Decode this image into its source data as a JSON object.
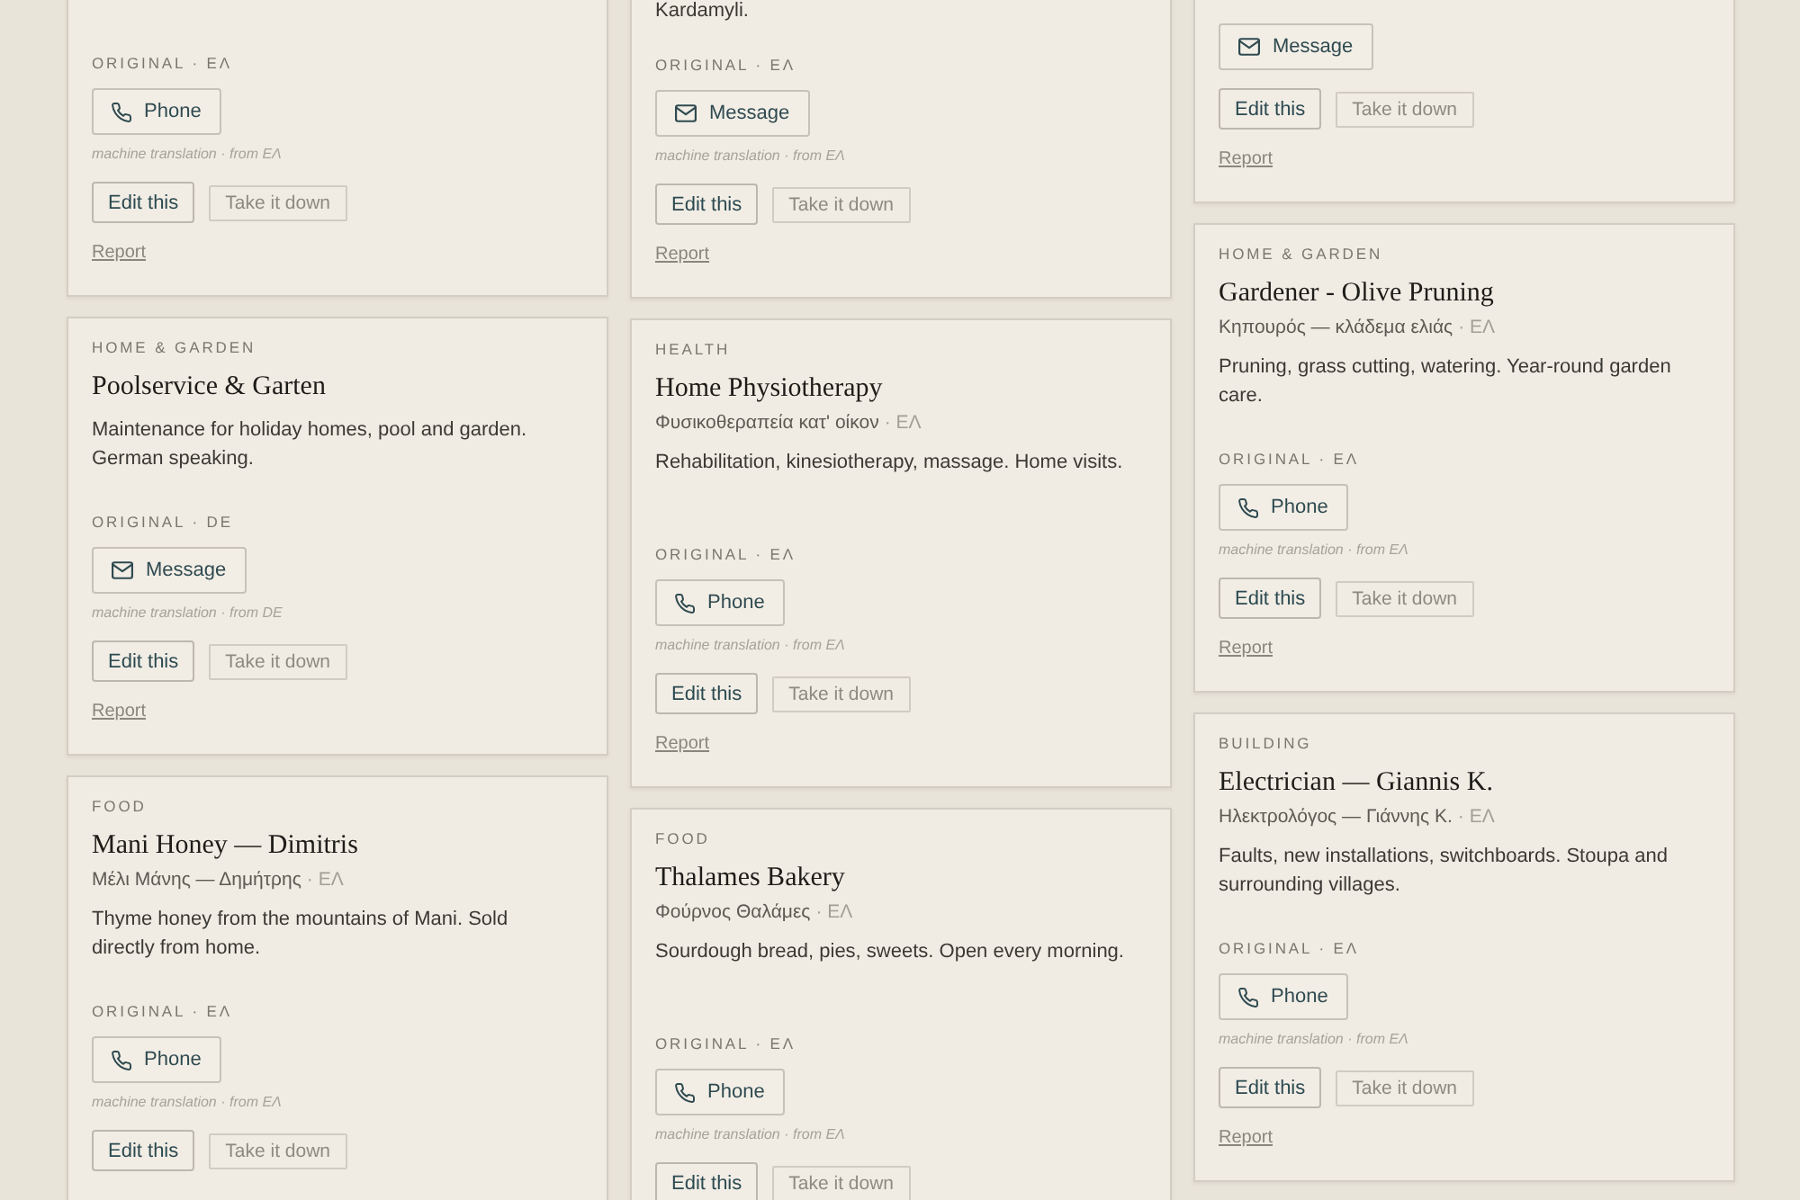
{
  "columns": [
    {
      "cards": [
        {
          "original_label": "ORIGINAL · ΕΛ",
          "contact": {
            "kind": "phone",
            "label": "Phone"
          },
          "translation_note": "machine translation · from ΕΛ",
          "edit_label": "Edit this",
          "take_down_label": "Take it down",
          "report_label": "Report"
        },
        {
          "category": "HOME & GARDEN",
          "title": "Poolservice & Garten",
          "description": "Maintenance for holiday homes, pool and garden. German speaking.",
          "original_label": "ORIGINAL · DE",
          "contact": {
            "kind": "message",
            "label": "Message"
          },
          "translation_note": "machine translation · from DE",
          "edit_label": "Edit this",
          "take_down_label": "Take it down",
          "report_label": "Report"
        },
        {
          "category": "FOOD",
          "title": "Mani Honey — Dimitris",
          "native_name": "Μέλι Μάνης — Δημήτρης",
          "native_lang": "· ΕΛ",
          "description": "Thyme honey from the mountains of Mani. Sold directly from home.",
          "original_label": "ORIGINAL · ΕΛ",
          "contact": {
            "kind": "phone",
            "label": "Phone"
          },
          "translation_note": "machine translation · from ΕΛ",
          "edit_label": "Edit this",
          "take_down_label": "Take it down"
        }
      ]
    },
    {
      "cards": [
        {
          "description": "Kardamyli.",
          "original_label": "ORIGINAL · ΕΛ",
          "contact": {
            "kind": "message",
            "label": "Message"
          },
          "translation_note": "machine translation · from ΕΛ",
          "edit_label": "Edit this",
          "take_down_label": "Take it down",
          "report_label": "Report"
        },
        {
          "category": "HEALTH",
          "title": "Home Physiotherapy",
          "native_name": "Φυσικοθεραπεία κατ' οίκον",
          "native_lang": "· ΕΛ",
          "description": "Rehabilitation, kinesiotherapy, massage. Home visits.",
          "original_label": "ORIGINAL · ΕΛ",
          "contact": {
            "kind": "phone",
            "label": "Phone"
          },
          "translation_note": "machine translation · from ΕΛ",
          "edit_label": "Edit this",
          "take_down_label": "Take it down",
          "report_label": "Report"
        },
        {
          "category": "FOOD",
          "title": "Thalames Bakery",
          "native_name": "Φούρνος Θαλάμες",
          "native_lang": "· ΕΛ",
          "description": "Sourdough bread, pies, sweets. Open every morning.",
          "original_label": "ORIGINAL · ΕΛ",
          "contact": {
            "kind": "phone",
            "label": "Phone"
          },
          "translation_note": "machine translation · from ΕΛ",
          "edit_label": "Edit this",
          "take_down_label": "Take it down"
        }
      ]
    },
    {
      "cards": [
        {
          "contact": {
            "kind": "message",
            "label": "Message"
          },
          "edit_label": "Edit this",
          "take_down_label": "Take it down",
          "report_label": "Report"
        },
        {
          "category": "HOME & GARDEN",
          "title": "Gardener - Olive Pruning",
          "native_name": "Κηπουρός — κλάδεμα ελιάς",
          "native_lang": "· ΕΛ",
          "description": "Pruning, grass cutting, watering. Year-round garden care.",
          "original_label": "ORIGINAL · ΕΛ",
          "contact": {
            "kind": "phone",
            "label": "Phone"
          },
          "translation_note": "machine translation · from ΕΛ",
          "edit_label": "Edit this",
          "take_down_label": "Take it down",
          "report_label": "Report"
        },
        {
          "category": "BUILDING",
          "title": "Electrician — Giannis K.",
          "native_name": "Ηλεκτρολόγος — Γιάννης Κ.",
          "native_lang": "· ΕΛ",
          "description": "Faults, new installations, switchboards. Stoupa and surrounding villages.",
          "original_label": "ORIGINAL · ΕΛ",
          "contact": {
            "kind": "phone",
            "label": "Phone"
          },
          "translation_note": "machine translation · from ΕΛ",
          "edit_label": "Edit this",
          "take_down_label": "Take it down",
          "report_label": "Report"
        }
      ]
    }
  ]
}
